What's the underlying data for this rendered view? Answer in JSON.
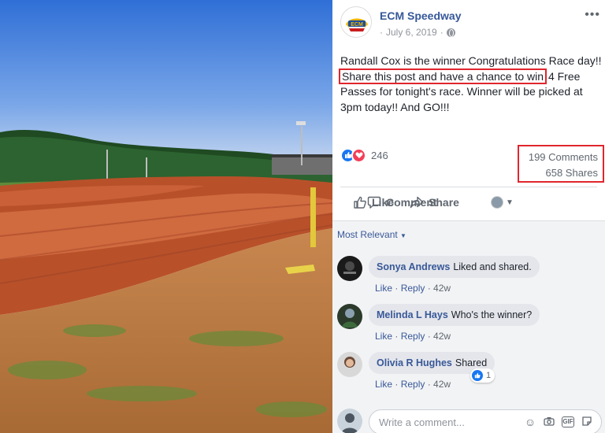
{
  "post": {
    "page_name": "ECM Speedway",
    "date": "July 6, 2019",
    "separator": "·",
    "text_before": "Randall Cox is the winner Congratulations Race day!!",
    "text_highlight": "Share this post and have a chance to win",
    "text_after": "4 Free Passes for tonight's race. Winner will be picked at 3pm today!! And GO!!!",
    "reaction_count": "246",
    "comments_count": "199 Comments",
    "shares_count": "658 Shares"
  },
  "actions": {
    "like": "Like",
    "comment": "Comment",
    "share": "Share"
  },
  "comments_section": {
    "sort_label": "Most Relevant",
    "items": [
      {
        "author": "Sonya Andrews",
        "text": "Liked and shared.",
        "like": "Like",
        "reply": "Reply",
        "time": "42w"
      },
      {
        "author": "Melinda L Hays",
        "text": "Who's the winner?",
        "like": "Like",
        "reply": "Reply",
        "time": "42w"
      },
      {
        "author": "Olivia R Hughes",
        "text": "Shared",
        "like": "Like",
        "reply": "Reply",
        "time": "42w",
        "reactions": "1"
      }
    ],
    "write_placeholder": "Write a comment...",
    "gif_label": "GIF"
  },
  "colors": {
    "link_blue": "#365899",
    "highlight_red": "#e0262d",
    "like_blue": "#1877f2",
    "love_red": "#f33e58",
    "clay": "#c0532b"
  },
  "icons": [
    "more-icon",
    "globe-icon",
    "like-reaction-icon",
    "love-reaction-icon",
    "like-icon",
    "comment-icon",
    "share-icon",
    "chevron-down-icon",
    "emoji-icon",
    "camera-icon",
    "gif-icon",
    "sticker-icon"
  ]
}
